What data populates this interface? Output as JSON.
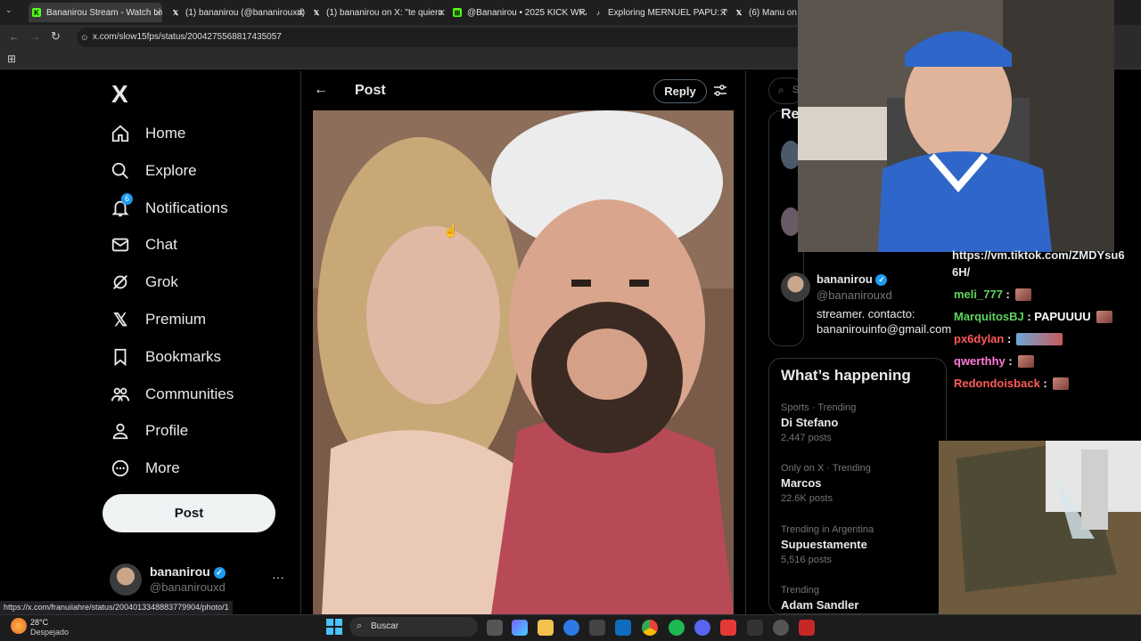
{
  "tabs": [
    {
      "title": "Bananirou Stream - Watch Live",
      "icon": "kick-icon",
      "color": "#53fc18"
    },
    {
      "title": "(1) bananirou (@bananirouxd) / X",
      "icon": "x-icon",
      "color": "#ffffff"
    },
    {
      "title": "(1) bananirou on X: \"te quiero",
      "icon": "x-icon",
      "color": "#ffffff"
    },
    {
      "title": "@Bananirou • 2025 KICK WRAP",
      "icon": "wrap-icon",
      "color": "#53fc18"
    },
    {
      "title": "Exploring MERNUEL PAPU: Twi",
      "icon": "tiktok-icon",
      "color": "#ffffff"
    },
    {
      "title": "(6) Manu on X: \"",
      "icon": "x-icon",
      "color": "#ffffff"
    }
  ],
  "address": {
    "url": "x.com/slow15fps/status/2004275568817435057"
  },
  "nav": {
    "logo": "X",
    "items": [
      {
        "label": "Home",
        "icon": "home-icon"
      },
      {
        "label": "Explore",
        "icon": "search-icon"
      },
      {
        "label": "Notifications",
        "icon": "bell-icon",
        "badge": "6"
      },
      {
        "label": "Chat",
        "icon": "mail-icon"
      },
      {
        "label": "Grok",
        "icon": "grok-icon"
      },
      {
        "label": "Premium",
        "icon": "x-icon"
      },
      {
        "label": "Bookmarks",
        "icon": "bookmark-icon"
      },
      {
        "label": "Communities",
        "icon": "communities-icon"
      },
      {
        "label": "Profile",
        "icon": "person-icon"
      },
      {
        "label": "More",
        "icon": "more-icon"
      }
    ],
    "post_label": "Post"
  },
  "account": {
    "name": "bananirou",
    "handle": "@bananirouxd"
  },
  "post_header": {
    "title": "Post",
    "reply_label": "Reply"
  },
  "sidebar": {
    "search_placeholder": "S",
    "relevant_heading": "Re",
    "profile": {
      "name": "bananirou",
      "handle": "@bananirouxd",
      "bio_line1": "streamer. contacto:",
      "bio_line2": "bananirouinfo@gmail.com"
    },
    "happening_title": "What’s happening",
    "trends": [
      {
        "context": "Sports · Trending",
        "name": "Di Stefano",
        "count": "2,447 posts"
      },
      {
        "context": "Only on X · Trending",
        "name": "Marcos",
        "count": "22.6K posts"
      },
      {
        "context": "Trending in Argentina",
        "name": "Supuestamente",
        "count": "5,516 posts"
      },
      {
        "context": "Trending",
        "name": "Adam Sandler",
        "count": ""
      }
    ]
  },
  "chat": {
    "link_line1": "https://vm.tiktok.com/ZMDYsu6",
    "link_line2": "6H/",
    "messages": [
      {
        "user": "meli_777",
        "text": "",
        "color": "#5fd35f"
      },
      {
        "user": "MarquitosBJ",
        "text": "PAPUUUU",
        "color": "#5fd35f"
      },
      {
        "user": "px6dylan",
        "text": "",
        "color": "#ff5a5a"
      },
      {
        "user": "qwerthhy",
        "text": "",
        "color": "#ff7ad9"
      },
      {
        "user": "Redondoisback",
        "text": "",
        "color": "#ff5a5a"
      }
    ]
  },
  "status_link": "https://x.com/franuiiahre/status/2004013348883779904/photo/1",
  "weather": {
    "temp": "28°C",
    "condition": "Despejado"
  },
  "taskbar": {
    "search_label": "Buscar"
  }
}
